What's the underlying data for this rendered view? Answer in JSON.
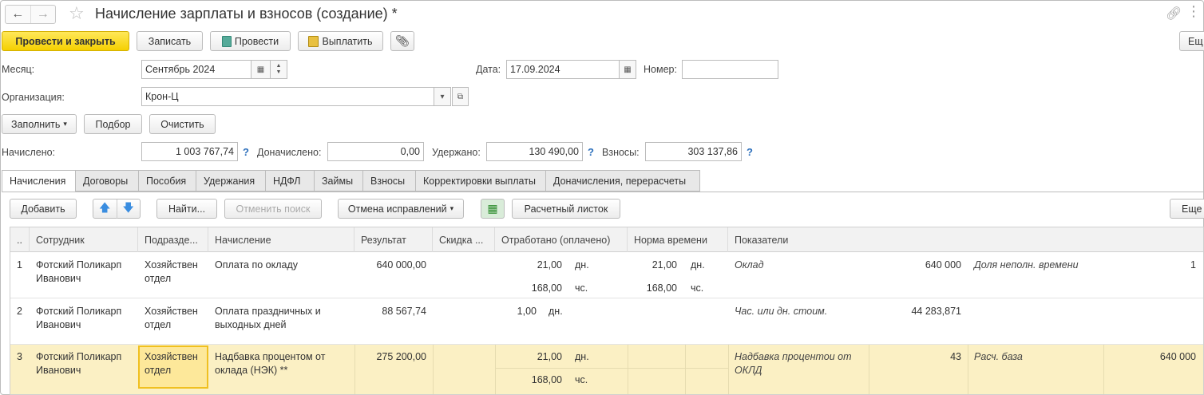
{
  "window": {
    "title": "Начисление зарплаты и взносов (создание) *"
  },
  "toolbar": {
    "post_close": "Провести и закрыть",
    "save": "Записать",
    "post": "Провести",
    "pay": "Выплатить",
    "more": "Ещ"
  },
  "header": {
    "month_label": "Месяц:",
    "month_value": "Сентябрь 2024",
    "date_label": "Дата:",
    "date_value": "17.09.2024",
    "number_label": "Номер:",
    "number_value": "",
    "org_label": "Организация:",
    "org_value": "Крон-Ц"
  },
  "actions": {
    "fill": "Заполнить",
    "select": "Подбор",
    "clear": "Очистить"
  },
  "totals": {
    "accrued_label": "Начислено:",
    "accrued_value": "1 003 767,74",
    "additional_label": "Доначислено:",
    "additional_value": "0,00",
    "withheld_label": "Удержано:",
    "withheld_value": "130 490,00",
    "contributions_label": "Взносы:",
    "contributions_value": "303 137,86",
    "help": "?"
  },
  "tabs": [
    "Начисления",
    "Договоры",
    "Пособия",
    "Удержания",
    "НДФЛ",
    "Займы",
    "Взносы",
    "Корректировки выплаты",
    "Доначисления, перерасчеты"
  ],
  "grid_toolbar": {
    "add": "Добавить",
    "find": "Найти...",
    "cancel_search": "Отменить поиск",
    "cancel_fixes": "Отмена исправлений",
    "payslip": "Расчетный листок",
    "more": "Еще"
  },
  "columns": [
    "..",
    "Сотрудник",
    "Подразде...",
    "Начисление",
    "Результат",
    "Скидка ...",
    "Отработано (оплачено)",
    "Норма времени",
    "Показатели"
  ],
  "rows": [
    {
      "n": "1",
      "employee": "Фотский Поликарп Иванович",
      "dept": "Хозяйствен отдел",
      "accrual": "Оплата по окладу",
      "result": "640 000,00",
      "worked_days": "21,00",
      "worked_days_unit": "дн.",
      "worked_hours": "168,00",
      "worked_hours_unit": "чс.",
      "norm_days": "21,00",
      "norm_days_unit": "дн.",
      "norm_hours": "168,00",
      "norm_hours_unit": "чс.",
      "ind1_name": "Оклад",
      "ind1_value": "640 000",
      "ind2_name": "Доля неполн. времени",
      "ind2_value": "1"
    },
    {
      "n": "2",
      "employee": "Фотский Поликарп Иванович",
      "dept": "Хозяйствен отдел",
      "accrual": "Оплата праздничных и выходных дней",
      "result": "88 567,74",
      "worked_days": "1,00",
      "worked_days_unit": "дн.",
      "ind1_name": "Час. или дн. стоим.",
      "ind1_value": "44 283,871"
    },
    {
      "n": "3",
      "employee": "Фотский Поликарп Иванович",
      "dept": "Хозяйствен отдел",
      "accrual": "Надбавка процентом от оклада (НЭК) **",
      "result": "275 200,00",
      "worked_days": "21,00",
      "worked_days_unit": "дн.",
      "worked_hours": "168,00",
      "worked_hours_unit": "чс.",
      "ind1_name": "Надбавка процентои от ОКЛД",
      "ind1_value": "43",
      "ind2_name": "Расч. база",
      "ind2_value": "640 000"
    }
  ]
}
